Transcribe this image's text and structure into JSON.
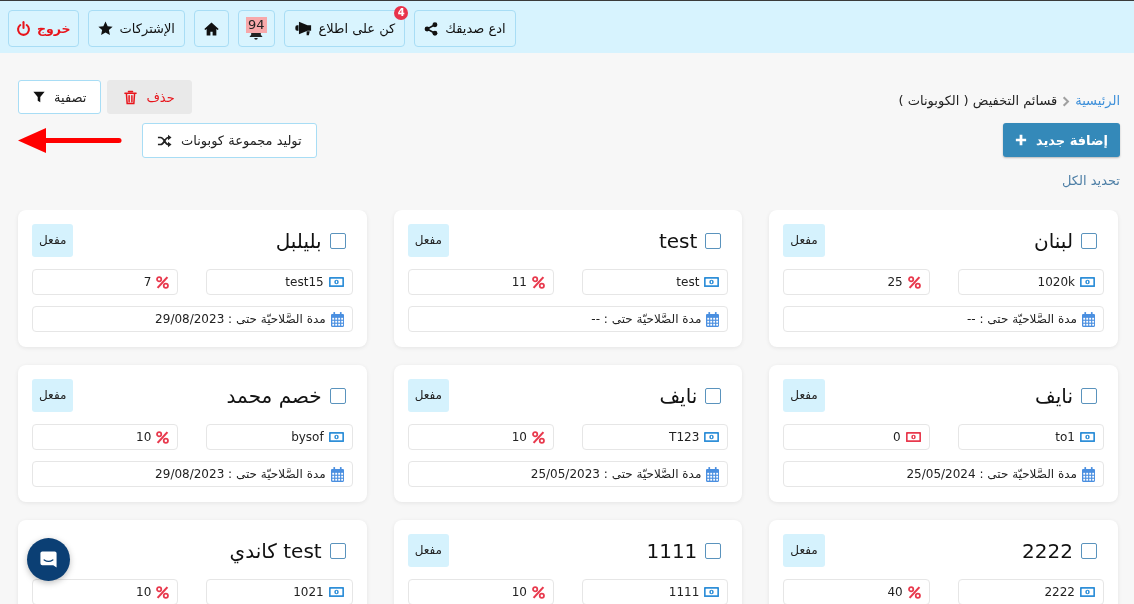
{
  "top_bar": {
    "buttons": [
      {
        "kind": "invite",
        "label": "ادع صديقك"
      },
      {
        "kind": "news",
        "label": "كن على اطلاع",
        "badge": "4"
      },
      {
        "kind": "notifications",
        "count": "94"
      },
      {
        "kind": "home"
      },
      {
        "kind": "subscriptions",
        "label": "الإشتركات"
      },
      {
        "kind": "logout",
        "label": "خروج"
      }
    ]
  },
  "breadcrumb": [
    {
      "kind": "link",
      "label": "الرئيسية"
    },
    {
      "kind": "current",
      "label": "قسائم التخفيض ( الكوبونات )"
    }
  ],
  "actions": {
    "add_button": "إضافة جديد",
    "select_all": "تحديد الكل",
    "delete_button": "حذف",
    "filter_button": "تصفية",
    "generate_button": "توليد مجموعة كوبونات"
  },
  "coupons": [
    {
      "title": "لبنان",
      "selected": false,
      "status": "مفعل",
      "code": "1020k",
      "discount": {
        "kind": "percent",
        "value": "25"
      },
      "validity": "مدة الصَّلاحيّة حتى : --"
    },
    {
      "title": "test",
      "selected": false,
      "status": "مفعل",
      "code": "test",
      "discount": {
        "kind": "percent",
        "value": "11"
      },
      "validity": "مدة الصَّلاحيّة حتى : --"
    },
    {
      "title": "بليلبل",
      "selected": false,
      "status": "مفعل",
      "code": "test15",
      "discount": {
        "kind": "percent",
        "value": "7"
      },
      "validity": "مدة الصَّلاحيّة حتى : 29/08/2023"
    },
    {
      "title": "نايف",
      "selected": false,
      "status": "مفعل",
      "code": "to1",
      "discount": {
        "kind": "amount",
        "value": "0"
      },
      "validity": "مدة الصَّلاحيّة حتى : 25/05/2024"
    },
    {
      "title": "نايف",
      "selected": false,
      "status": "مفعل",
      "code": "T123",
      "discount": {
        "kind": "percent",
        "value": "10"
      },
      "validity": "مدة الصَّلاحيّة حتى : 25/05/2023"
    },
    {
      "title": "خصم محمد",
      "selected": false,
      "status": "مفعل",
      "code": "bysof",
      "discount": {
        "kind": "percent",
        "value": "10"
      },
      "validity": "مدة الصَّلاحيّة حتى : 29/08/2023"
    },
    {
      "title": "2222",
      "selected": false,
      "status": "مفعل",
      "code": "2222",
      "discount": {
        "kind": "percent",
        "value": "40"
      }
    },
    {
      "title": "1111",
      "selected": false,
      "status": "مفعل",
      "code": "1111",
      "discount": {
        "kind": "percent",
        "value": "10"
      }
    },
    {
      "title": "test كاندي",
      "selected": false,
      "code": "1021",
      "discount": {
        "kind": "percent",
        "value": "10"
      }
    }
  ]
}
